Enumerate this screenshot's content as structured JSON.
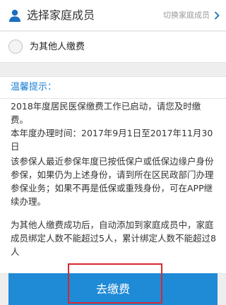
{
  "header": {
    "title": "选择家庭成员",
    "switch_label": "切换家庭成员",
    "user_icon": "user-icon",
    "chevron_icon": "chevron-right-icon"
  },
  "option": {
    "label": "为其他人缴费",
    "selected": false
  },
  "notice": {
    "title": "温馨提示：",
    "paragraph1": "2018年度居民医保缴费工作已启动，请您及时缴费。\n本年度办理时间：2017年9月1日至2017年11月30日",
    "paragraph2": "该参保人最近参保年度已按低保户或低保边缘户身份参保，如果仍为上述身份，请到所在区民政部门办理参保业务；如果不再是低保或重残身份，可在APP继续办理。",
    "paragraph3": "为其他人缴费成功后，自动添加到家庭成员中，家庭成员绑定人数不能超过5人，累计绑定人数不能超过8人"
  },
  "button": {
    "label": "去缴费"
  },
  "colors": {
    "accent": "#1f8ad6",
    "link": "#1a7fd1",
    "highlight": "#d9272e",
    "icon": "#1a6fbf"
  }
}
